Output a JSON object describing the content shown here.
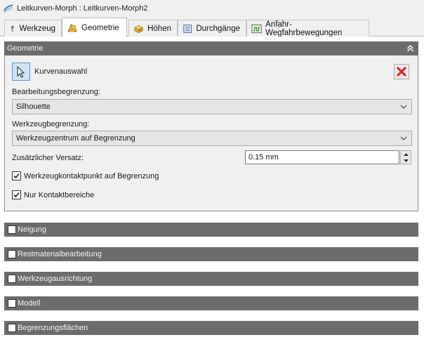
{
  "window": {
    "title": "Leitkurven-Morph : Leitkurven-Morph2"
  },
  "tabs": [
    {
      "label": "Werkzeug",
      "icon": "tool-icon"
    },
    {
      "label": "Geometrie",
      "icon": "geometry-icon",
      "active": true
    },
    {
      "label": "Höhen",
      "icon": "heights-icon"
    },
    {
      "label": "Durchgänge",
      "icon": "passes-icon"
    },
    {
      "label": "Anfahr-Wegfahrbewegungen",
      "icon": "linking-icon"
    }
  ],
  "geometry": {
    "header": "Geometrie",
    "curve_selection_label": "Kurvenauswahl",
    "machining_boundary_label": "Bearbeitungsbegrenzung:",
    "machining_boundary_value": "Silhouette",
    "tool_containment_label": "Werkzeugbegrenzung:",
    "tool_containment_value": "Werkzeugzentrum auf Begrenzung",
    "additional_offset_label": "Zusätzlicher Versatz:",
    "additional_offset_value": "0.15 mm",
    "tool_contact_point_label": "Werkzeugkontaktpunkt auf Begrenzung",
    "tool_contact_point_checked": true,
    "contact_only_label": "Nur Kontaktbereiche",
    "contact_only_checked": true
  },
  "sections": [
    {
      "label": "Neigung",
      "checked": false
    },
    {
      "label": "Restmaterialbearbeitung",
      "checked": false
    },
    {
      "label": "Werkzeugausrichtung",
      "checked": false
    },
    {
      "label": "Modell",
      "checked": false
    },
    {
      "label": "Begrenzungsflächen",
      "checked": false
    }
  ],
  "colors": {
    "section_header": "#6c6c6c",
    "selection_blue": "#cfe3f6",
    "delete_red": "#d92b2b"
  }
}
